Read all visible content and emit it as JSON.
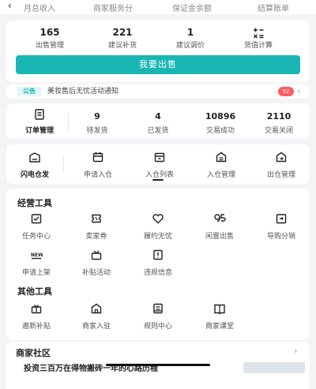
{
  "topnav": {
    "back": "‹",
    "items": [
      "月总收入",
      "商家服务分",
      "保证金余额",
      "结算账单"
    ],
    "close": "✕"
  },
  "stats": [
    {
      "value": "165",
      "label": "出售管理"
    },
    {
      "value": "221",
      "label": "建议补货"
    },
    {
      "value": "1",
      "label": "建议调价"
    },
    {
      "value": "",
      "label": "货值计算",
      "icon": "calculator-icon"
    }
  ],
  "sell_button": "我要出售",
  "notice": {
    "tag": "公告",
    "text": "美妆售后无忧活动通知",
    "badge": "92"
  },
  "orders": {
    "main_label": "订单管理",
    "items": [
      {
        "value": "9",
        "label": "待发货"
      },
      {
        "value": "4",
        "label": "已发货"
      },
      {
        "value": "10896",
        "label": "交易成功"
      },
      {
        "value": "2110",
        "label": "交易关闭"
      }
    ]
  },
  "flash": {
    "items": [
      {
        "label": "闪电仓发",
        "icon": "warehouse-icon"
      },
      {
        "label": "申请入仓",
        "icon": "calendar-icon"
      },
      {
        "label": "入仓列表",
        "icon": "box-icon"
      },
      {
        "label": "入仓管理",
        "icon": "house-icon"
      },
      {
        "label": "出仓管理",
        "icon": "house-out-icon"
      }
    ]
  },
  "tools": {
    "title": "经营工具",
    "items": [
      {
        "label": "任务中心",
        "icon": "task-icon"
      },
      {
        "label": "卖家券",
        "icon": "coupon-icon"
      },
      {
        "label": "履约无忧",
        "icon": "heart-shield-icon"
      },
      {
        "label": "闲置出售",
        "icon": "idle-sell-icon"
      },
      {
        "label": "导购分销",
        "icon": "share-icon"
      },
      {
        "label": "申请上架",
        "icon": "new-icon"
      },
      {
        "label": "补贴活动",
        "icon": "gift-icon"
      },
      {
        "label": "违规信息",
        "icon": "warning-doc-icon"
      }
    ]
  },
  "other_tools": {
    "title": "其他工具",
    "items": [
      {
        "label": "邀新补贴",
        "icon": "gift-box-icon"
      },
      {
        "label": "商家入驻",
        "icon": "shop-icon"
      },
      {
        "label": "规则中心",
        "icon": "rules-icon"
      },
      {
        "label": "商家课堂",
        "icon": "book-icon"
      }
    ]
  },
  "community": {
    "title": "商家社区",
    "post": "投资三百万在得物搬砖一年的心路历程"
  },
  "colors": {
    "accent": "#1ab6b4",
    "badge": "#ff5a5f",
    "background": "#f3f4f6"
  }
}
